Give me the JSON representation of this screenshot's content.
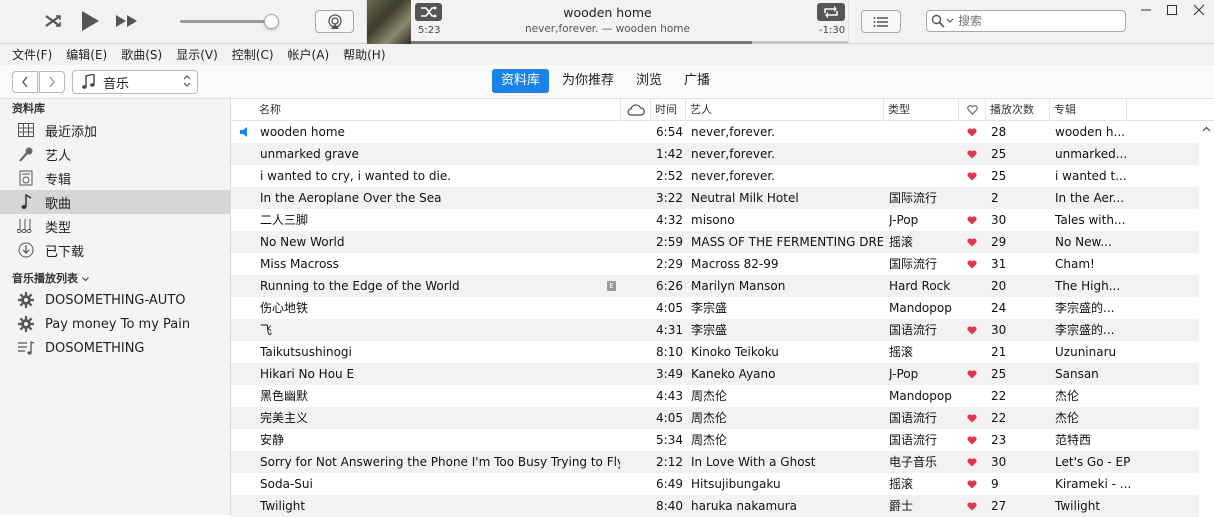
{
  "now_playing": {
    "title": "wooden home",
    "subtitle": "never,forever. — wooden home",
    "elapsed": "5:23",
    "remaining": "-1:30",
    "progress": 0.78,
    "volume": 0.92
  },
  "search": {
    "placeholder": "搜索"
  },
  "menu": [
    "文件(F)",
    "编辑(E)",
    "歌曲(S)",
    "显示(V)",
    "控制(C)",
    "帐户(A)",
    "帮助(H)"
  ],
  "media_selector": {
    "label": "音乐"
  },
  "tabs": [
    {
      "label": "资料库",
      "active": true
    },
    {
      "label": "为你推荐",
      "active": false
    },
    {
      "label": "浏览",
      "active": false
    },
    {
      "label": "广播",
      "active": false
    }
  ],
  "sidebar": {
    "library_header": "资料库",
    "library_items": [
      {
        "label": "最近添加",
        "icon": "grid-icon"
      },
      {
        "label": "艺人",
        "icon": "microphone-icon"
      },
      {
        "label": "专辑",
        "icon": "album-icon"
      },
      {
        "label": "歌曲",
        "icon": "music-note-icon",
        "selected": true
      },
      {
        "label": "类型",
        "icon": "genre-icon"
      },
      {
        "label": "已下载",
        "icon": "download-icon"
      }
    ],
    "playlists_header": "音乐播放列表",
    "playlists": [
      {
        "label": "DOSOMETHING-AUTO",
        "icon": "gear-icon"
      },
      {
        "label": "Pay money To my Pain",
        "icon": "gear-icon"
      },
      {
        "label": "DOSOMETHING",
        "icon": "playlist-icon"
      }
    ]
  },
  "columns": {
    "name": "名称",
    "time": "时间",
    "artist": "艺人",
    "genre": "类型",
    "plays": "播放次数",
    "album": "专辑"
  },
  "songs": [
    {
      "name": "wooden home",
      "time": "6:54",
      "artist": "never,forever.",
      "genre": "",
      "loved": true,
      "plays": "28",
      "album": "wooden h...",
      "playing": true
    },
    {
      "name": "unmarked grave",
      "time": "1:42",
      "artist": "never,forever.",
      "genre": "",
      "loved": true,
      "plays": "25",
      "album": "unmarked..."
    },
    {
      "name": "i wanted to cry, i wanted to die.",
      "time": "2:52",
      "artist": "never,forever.",
      "genre": "",
      "loved": true,
      "plays": "25",
      "album": "i wanted t..."
    },
    {
      "name": "In the Aeroplane Over the Sea",
      "time": "3:22",
      "artist": "Neutral Milk Hotel",
      "genre": "国际流行",
      "loved": false,
      "plays": "2",
      "album": "In the Aer..."
    },
    {
      "name": "二人三脚",
      "time": "4:32",
      "artist": "misono",
      "genre": "J-Pop",
      "loved": true,
      "plays": "30",
      "album": "Tales with..."
    },
    {
      "name": "No New World",
      "time": "2:59",
      "artist": "MASS OF THE FERMENTING DREGS",
      "genre": "摇滚",
      "loved": true,
      "plays": "29",
      "album": "No New..."
    },
    {
      "name": "Miss Macross",
      "time": "2:29",
      "artist": "Macross 82-99",
      "genre": "国际流行",
      "loved": true,
      "plays": "31",
      "album": "Cham!"
    },
    {
      "name": "Running to the Edge of the World",
      "time": "6:26",
      "artist": "Marilyn Manson",
      "genre": "Hard Rock",
      "loved": false,
      "plays": "20",
      "album": "The High...",
      "explicit": "E"
    },
    {
      "name": "伤心地铁",
      "time": "4:05",
      "artist": "李宗盛",
      "genre": "Mandopop",
      "loved": false,
      "plays": "24",
      "album": "李宗盛的..."
    },
    {
      "name": "飞",
      "time": "4:31",
      "artist": "李宗盛",
      "genre": "国语流行",
      "loved": true,
      "plays": "30",
      "album": "李宗盛的..."
    },
    {
      "name": "Taikutsushinogi",
      "time": "8:10",
      "artist": "Kinoko Teikoku",
      "genre": "摇滚",
      "loved": false,
      "plays": "21",
      "album": "Uzuninaru"
    },
    {
      "name": "Hikari No Hou E",
      "time": "3:49",
      "artist": "Kaneko Ayano",
      "genre": "J-Pop",
      "loved": true,
      "plays": "25",
      "album": "Sansan"
    },
    {
      "name": "黑色幽默",
      "time": "4:43",
      "artist": "周杰伦",
      "genre": "Mandopop",
      "loved": false,
      "plays": "22",
      "album": "杰伦"
    },
    {
      "name": "完美主义",
      "time": "4:05",
      "artist": "周杰伦",
      "genre": "国语流行",
      "loved": true,
      "plays": "22",
      "album": "杰伦"
    },
    {
      "name": "安静",
      "time": "5:34",
      "artist": "周杰伦",
      "genre": "国语流行",
      "loved": true,
      "plays": "23",
      "album": "范特西"
    },
    {
      "name": "Sorry for Not Answering the Phone I'm Too Busy Trying to Fly Away",
      "time": "2:12",
      "artist": "In Love With a Ghost",
      "genre": "电子音乐",
      "loved": true,
      "plays": "30",
      "album": "Let's Go - EP"
    },
    {
      "name": "Soda-Sui",
      "time": "6:49",
      "artist": "Hitsujibungaku",
      "genre": "摇滚",
      "loved": true,
      "plays": "9",
      "album": "Kirameki - ..."
    },
    {
      "name": "Twilight",
      "time": "8:40",
      "artist": "haruka nakamura",
      "genre": "爵士",
      "loved": true,
      "plays": "27",
      "album": "Twilight"
    }
  ],
  "colors": {
    "accent": "#1b82e6",
    "heart": "#e4324f",
    "selected_sidebar": "#d6d6d6"
  }
}
